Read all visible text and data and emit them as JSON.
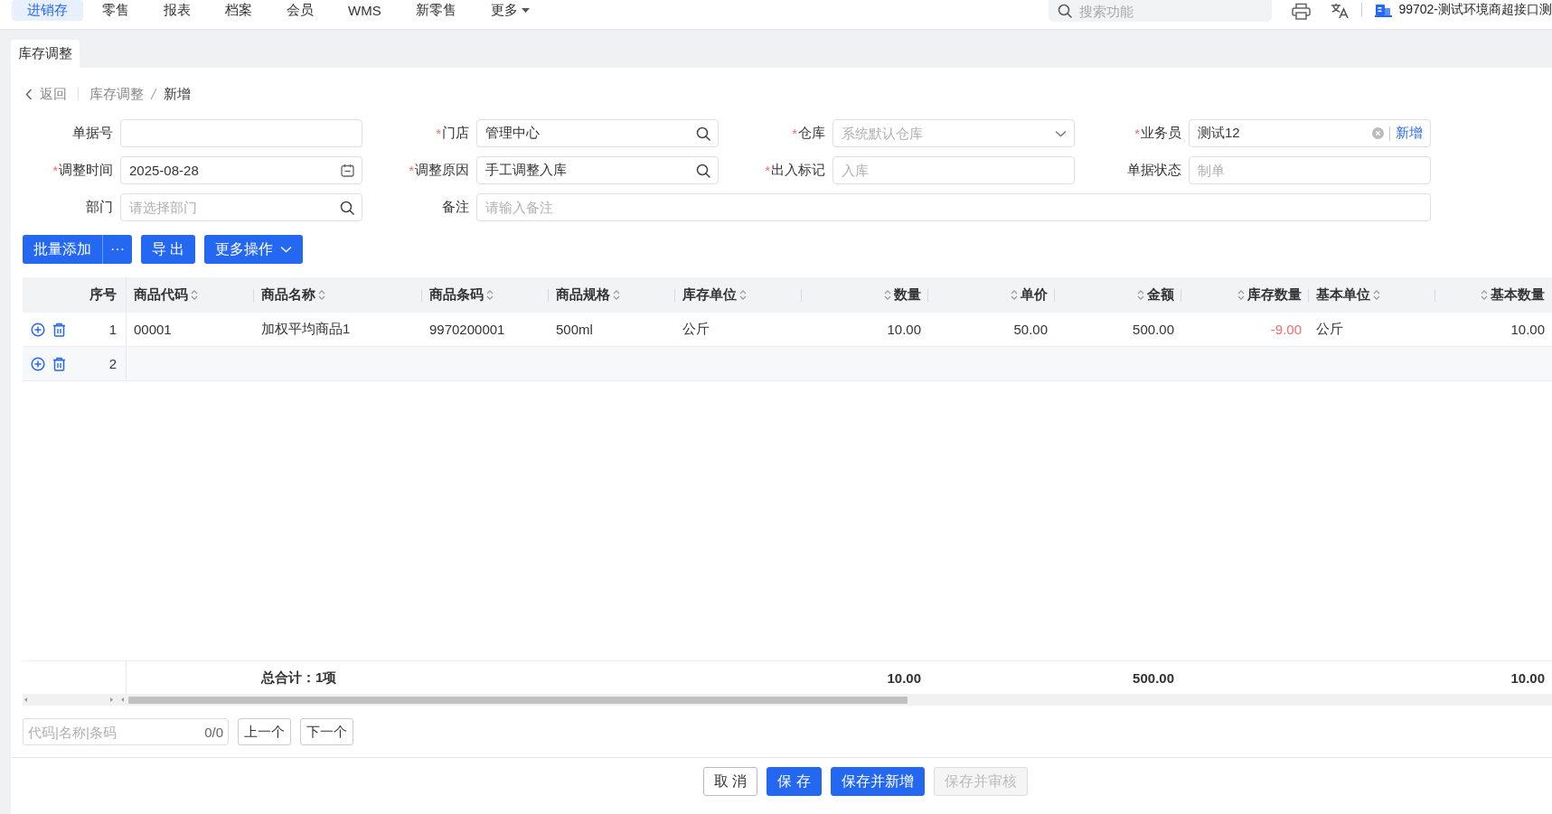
{
  "nav": {
    "tabs": [
      {
        "label": "进销存",
        "kind": "link",
        "selected": true
      },
      {
        "label": "零售",
        "kind": "link",
        "selected": false
      },
      {
        "label": "报表",
        "kind": "link",
        "selected": false
      },
      {
        "label": "档案",
        "kind": "link",
        "selected": false
      },
      {
        "label": "会员",
        "kind": "link",
        "selected": false
      },
      {
        "label": "WMS",
        "kind": "link",
        "selected": false
      },
      {
        "label": "新零售",
        "kind": "link",
        "selected": false
      },
      {
        "label": "更多",
        "kind": "dropdown",
        "selected": false
      }
    ],
    "search": {
      "placeholder": "搜索功能"
    },
    "account": "99702-测试环境商超接口测"
  },
  "page_tabs": [
    {
      "label": "库存调整",
      "selected": true
    }
  ],
  "breadcrumb": {
    "back": "返回",
    "items": [
      {
        "label": "库存调整",
        "current": false
      },
      {
        "label": "新增",
        "current": true
      }
    ]
  },
  "form": {
    "fields": [
      {
        "label": "单据号",
        "kind": "text"
      },
      {
        "label": "门店",
        "required_mark": "*",
        "kind": "search",
        "value": "管理中心"
      },
      {
        "label": "仓库",
        "required_mark": "*",
        "kind": "select",
        "placeholder": "系统默认仓库"
      },
      {
        "label": "业务员",
        "required_mark": "*",
        "kind": "person",
        "value": "测试12",
        "action": "新增"
      },
      {
        "label": "调整时间",
        "required_mark": "*",
        "kind": "date",
        "value": "2025-08-28"
      },
      {
        "label": "调整原因",
        "required_mark": "*",
        "kind": "search",
        "value": "手工调整入库"
      },
      {
        "label": "出入标记",
        "required_mark": "*",
        "kind": "text",
        "placeholder": "入库"
      },
      {
        "label": "单据状态",
        "kind": "text",
        "placeholder": "制单"
      },
      {
        "label": "部门",
        "kind": "search",
        "placeholder": "请选择部门"
      },
      {
        "label": "备注",
        "kind": "wide",
        "placeholder": "请输入备注"
      }
    ]
  },
  "toolbar": [
    {
      "label": "批量添加",
      "kind": "split",
      "extra": "···"
    },
    {
      "label": "导 出",
      "kind": "plain"
    },
    {
      "label": "更多操作",
      "kind": "dropdown"
    }
  ],
  "table": {
    "columns": [
      {
        "label": "序号",
        "kind": "index",
        "sortable": false
      },
      {
        "label": "商品代码",
        "kind": "text",
        "sortable": true
      },
      {
        "label": "商品名称",
        "kind": "text",
        "sortable": true,
        "total": "总合计：1项"
      },
      {
        "label": "商品条码",
        "kind": "text",
        "sortable": true
      },
      {
        "label": "商品规格",
        "kind": "text",
        "sortable": true
      },
      {
        "label": "库存单位",
        "kind": "text",
        "sortable": true
      },
      {
        "label": "数量",
        "kind": "number",
        "sortable": true,
        "total": "10.00"
      },
      {
        "label": "单价",
        "kind": "number",
        "sortable": true
      },
      {
        "label": "金额",
        "kind": "number",
        "sortable": true,
        "total": "500.00"
      },
      {
        "label": "库存数量",
        "kind": "stock",
        "sortable": true
      },
      {
        "label": "基本单位",
        "kind": "text",
        "sortable": true
      },
      {
        "label": "基本数量",
        "kind": "number",
        "sortable": true,
        "total": "10.00"
      }
    ],
    "rows": [
      {
        "index": "1",
        "low_stock": true,
        "cells": [
          "00001",
          "加权平均商品1",
          "9970200001",
          "500ml",
          "公斤",
          "10.00",
          "50.00",
          "500.00",
          "-9.00",
          "公斤",
          "10.00"
        ]
      },
      {
        "index": "2"
      }
    ]
  },
  "pager": {
    "placeholder": "代码|名称|条码",
    "count": "0/0",
    "prev": "上一个",
    "next": "下一个"
  },
  "actions": [
    {
      "label": "取 消",
      "kind": "default",
      "disabled": false
    },
    {
      "label": "保 存",
      "kind": "primary",
      "disabled": false
    },
    {
      "label": "保存并新增",
      "kind": "primary",
      "disabled": false
    },
    {
      "label": "保存并审核",
      "kind": "primary",
      "disabled": true
    }
  ]
}
